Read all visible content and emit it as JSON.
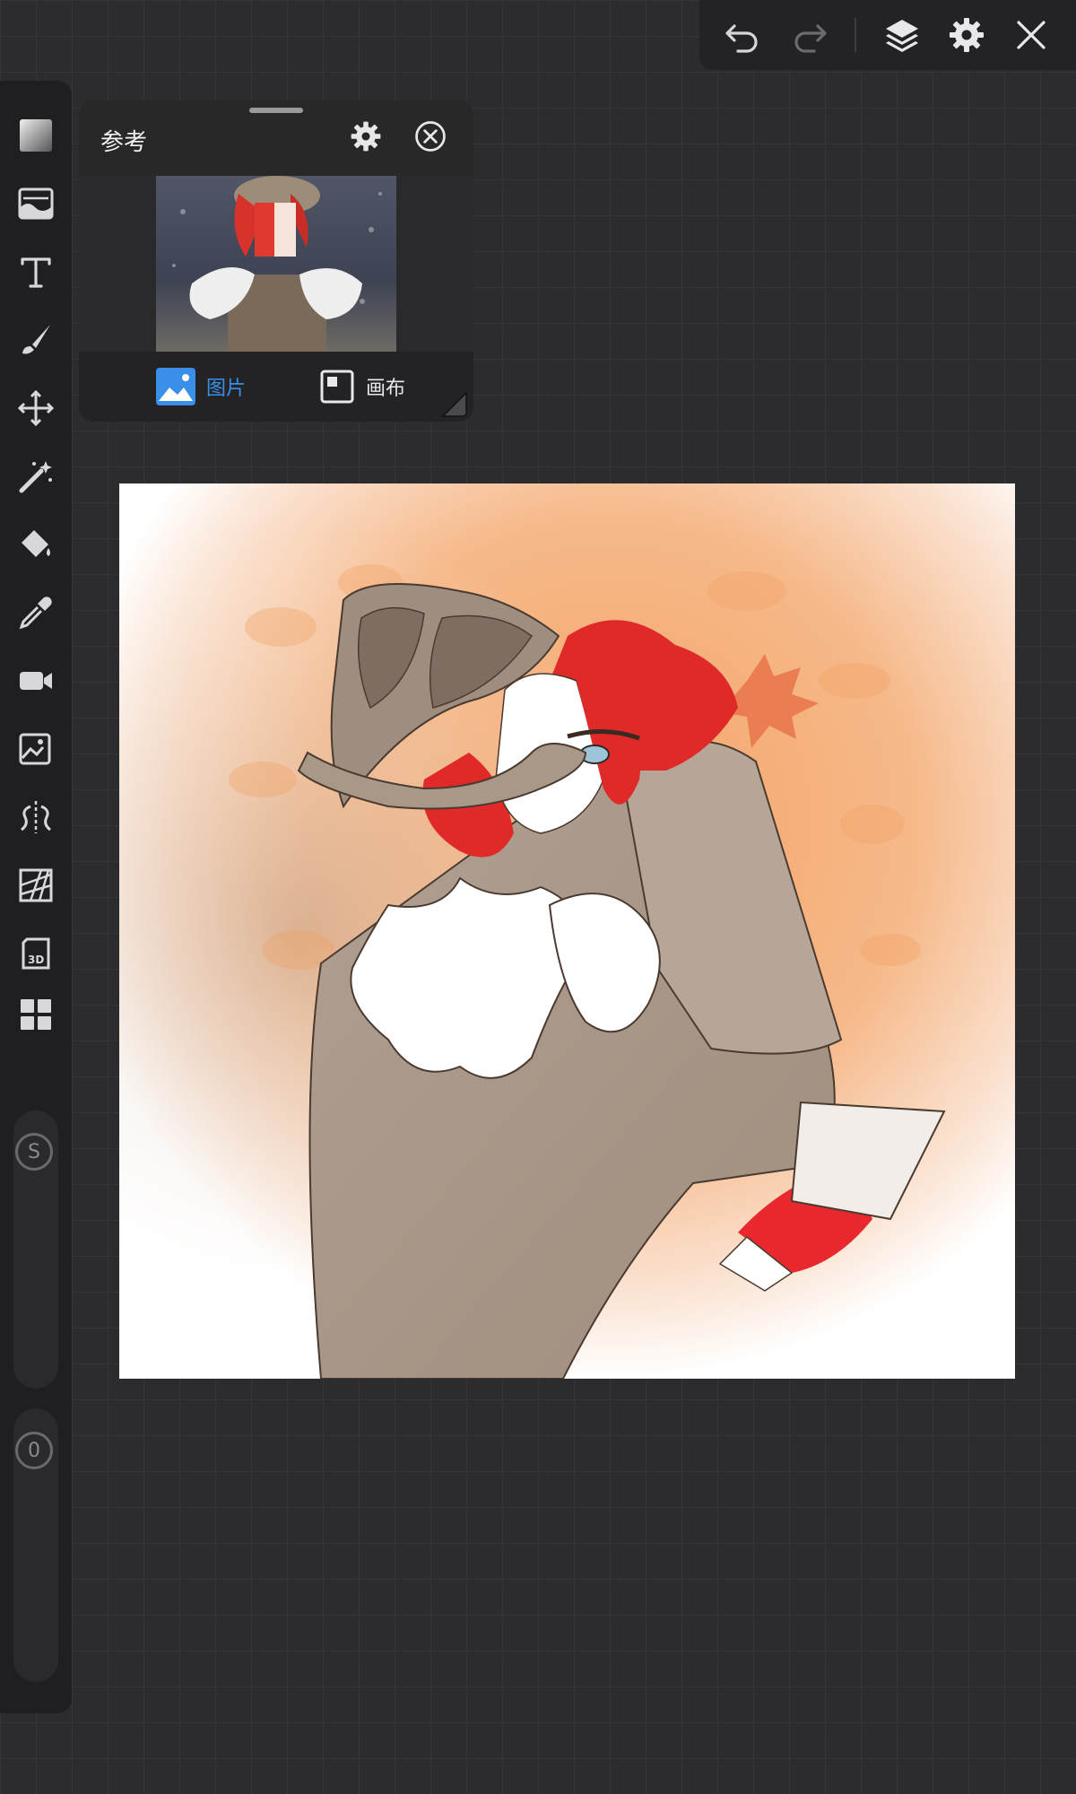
{
  "topbar": {
    "undo_icon": "undo-icon",
    "redo_icon": "redo-icon",
    "layers_icon": "layers-icon",
    "settings_icon": "gear-icon",
    "close_icon": "close-icon"
  },
  "toolbar": {
    "tools": [
      "gradient-tool",
      "filter-tool",
      "text-tool",
      "brush-tool",
      "transform-tool",
      "magic-wand-tool",
      "fill-bucket-tool",
      "eyedropper-tool",
      "video-record-tool",
      "image-adjust-tool",
      "symmetry-tool",
      "perspective-tool",
      "3d-tool",
      "more-tools"
    ],
    "size_badge": "S",
    "opacity_badge": "0"
  },
  "reference_panel": {
    "title": "参考",
    "tab_image": "图片",
    "tab_canvas": "画布",
    "active_tab": "image",
    "accent_color": "#3a8fe8"
  },
  "canvas": {
    "background": "#ffffff"
  }
}
